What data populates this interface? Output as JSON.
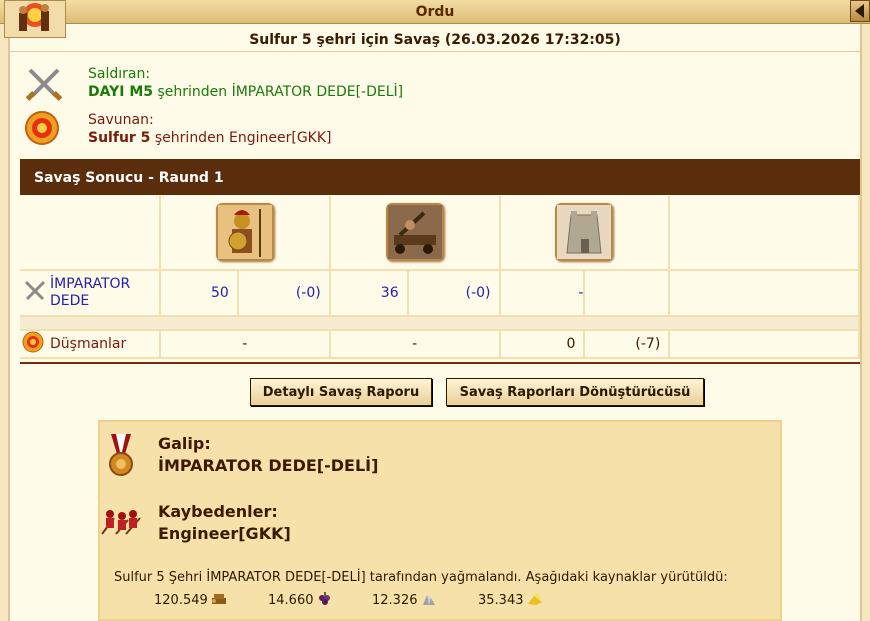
{
  "window": {
    "title": "Ordu"
  },
  "battle": {
    "heading": "Sulfur 5 şehri için Savaş (26.03.2026 17:32:05)",
    "attacker": {
      "label": "Saldıran:",
      "city": "DAYI M5",
      "suffix": " şehrinden İMPARATOR DEDE[-DELİ]"
    },
    "defender": {
      "label": "Savunan:",
      "city": "Sulfur 5",
      "suffix": " şehrinden Engineer[GKK]"
    },
    "result_title": "Savaş Sonucu - Raund 1"
  },
  "units_table": {
    "units": [
      {
        "name": "spearman-unit",
        "icon": "hoplite"
      },
      {
        "name": "catapult-unit",
        "icon": "catapult"
      },
      {
        "name": "wall-unit",
        "icon": "wall"
      }
    ],
    "attacker_row": {
      "name": "İMPARATOR DEDE",
      "cells": [
        {
          "count": "50",
          "loss": "(-0)"
        },
        {
          "count": "36",
          "loss": "(-0)"
        },
        {
          "count": "-",
          "loss": ""
        }
      ]
    },
    "enemy_row": {
      "name": "Düşmanlar",
      "cells": [
        {
          "count": "-",
          "loss": ""
        },
        {
          "count": "-",
          "loss": ""
        },
        {
          "count": "0",
          "loss": "(-7)"
        }
      ]
    }
  },
  "buttons": {
    "detailed_report": "Detaylı Savaş Raporu",
    "report_converter": "Savaş Raporları Dönüştürücüsü"
  },
  "summary": {
    "winner_label": "Galip:",
    "winner_name": "İMPARATOR DEDE[-DELİ]",
    "losers_label": "Kaybedenler:",
    "losers_name": "Engineer[GKK]",
    "loot_text": "Sulfur 5 Şehri İMPARATOR DEDE[-DELİ] tarafından yağmalandı. Aşağıdaki kaynaklar yürütüldü:",
    "loot": [
      {
        "amount": "120.549",
        "icon": "wood-icon"
      },
      {
        "amount": "14.660",
        "icon": "wine-icon"
      },
      {
        "amount": "12.326",
        "icon": "marble-icon"
      },
      {
        "amount": "35.343",
        "icon": "sulfur-icon"
      }
    ]
  },
  "colors": {
    "header_brown": "#5a2e0c",
    "bg_parchment": "#fffbe9",
    "link_blue": "#2222aa",
    "green": "#1a7a0a"
  }
}
